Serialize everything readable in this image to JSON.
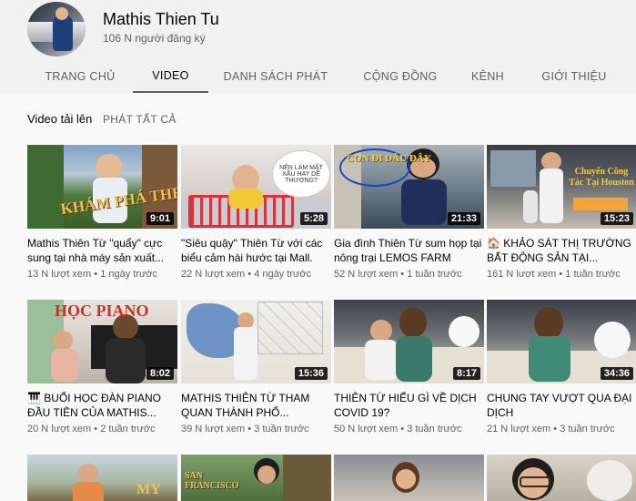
{
  "channel": {
    "name": "Mathis Thien Tu",
    "subscribers": "106 N người đăng ký"
  },
  "tabs": [
    {
      "label": "TRANG CHỦ"
    },
    {
      "label": "VIDEO"
    },
    {
      "label": "DANH SÁCH PHÁT"
    },
    {
      "label": "CỘNG ĐỒNG"
    },
    {
      "label": "KÊNH"
    },
    {
      "label": "GIỚI THIỆU"
    }
  ],
  "section": {
    "title": "Video tải lên",
    "play_all": "PHÁT TẤT CẢ"
  },
  "videos": [
    {
      "title": "Mathis Thiên Từ \"quẩy\" cực sung tại nhà máy sản xuất...",
      "views": "13 N lượt xem",
      "age": "1 ngày trước",
      "duration": "9:01",
      "overlay": "KHÁM PHÁ THE MALL"
    },
    {
      "title": "\"Siêu quậy\" Thiên Từ với các biểu cảm hài hước tại Mall.",
      "views": "22 N lượt xem",
      "age": "4 ngày trước",
      "duration": "5:28",
      "overlay": "NÊN LÀM MẶT XẤU HAY DỄ THƯƠNG?"
    },
    {
      "title": "Gia đình Thiên Từ sum họp tại nông trại LEMOS FARM",
      "views": "52 N lượt xem",
      "age": "1 tuần trước",
      "duration": "21:33",
      "overlay": "CON ĐI DÂU ĐÂY"
    },
    {
      "title": "🏠 KHẢO SÁT THỊ TRƯỜNG BẤT ĐỘNG SẢN TẠI...",
      "views": "161 N lượt xem",
      "age": "1 tuần trước",
      "duration": "15:23",
      "overlay": "Chuyến Công Tác Tại Houston"
    },
    {
      "title": "🎹 BUỔI HỌC ĐÀN PIANO ĐẦU TIÊN CỦA MATHIS...",
      "views": "20 N lượt xem",
      "age": "2 tuần trước",
      "duration": "8:02",
      "overlay": "HỌC PIANO"
    },
    {
      "title": "MATHIS THIÊN TỪ THAM QUAN THÀNH PHỐ...",
      "views": "39 N lượt xem",
      "age": "3 tuần trước",
      "duration": "15:36",
      "overlay": ""
    },
    {
      "title": "THIÊN TỪ HIỂU GÌ VỀ DỊCH COVID 19?",
      "views": "50 N lượt xem",
      "age": "3 tuần trước",
      "duration": "8:17",
      "overlay": ""
    },
    {
      "title": "CHUNG TAY VƯỢT QUA ĐẠI DỊCH",
      "views": "21 N lượt xem",
      "age": "3 tuần trước",
      "duration": "34:36",
      "overlay": ""
    },
    {
      "title": "",
      "views": "",
      "age": "",
      "duration": "",
      "overlay": "MY"
    },
    {
      "title": "",
      "views": "",
      "age": "",
      "duration": "",
      "overlay": "SAN FRANCISCO"
    },
    {
      "title": "",
      "views": "",
      "age": "",
      "duration": "",
      "overlay": ""
    },
    {
      "title": "",
      "views": "",
      "age": "",
      "duration": "",
      "overlay": ""
    }
  ],
  "colors": {
    "header_bg": "#f1f1f1",
    "page_bg": "#f9f9f9",
    "text_secondary": "#606060"
  }
}
